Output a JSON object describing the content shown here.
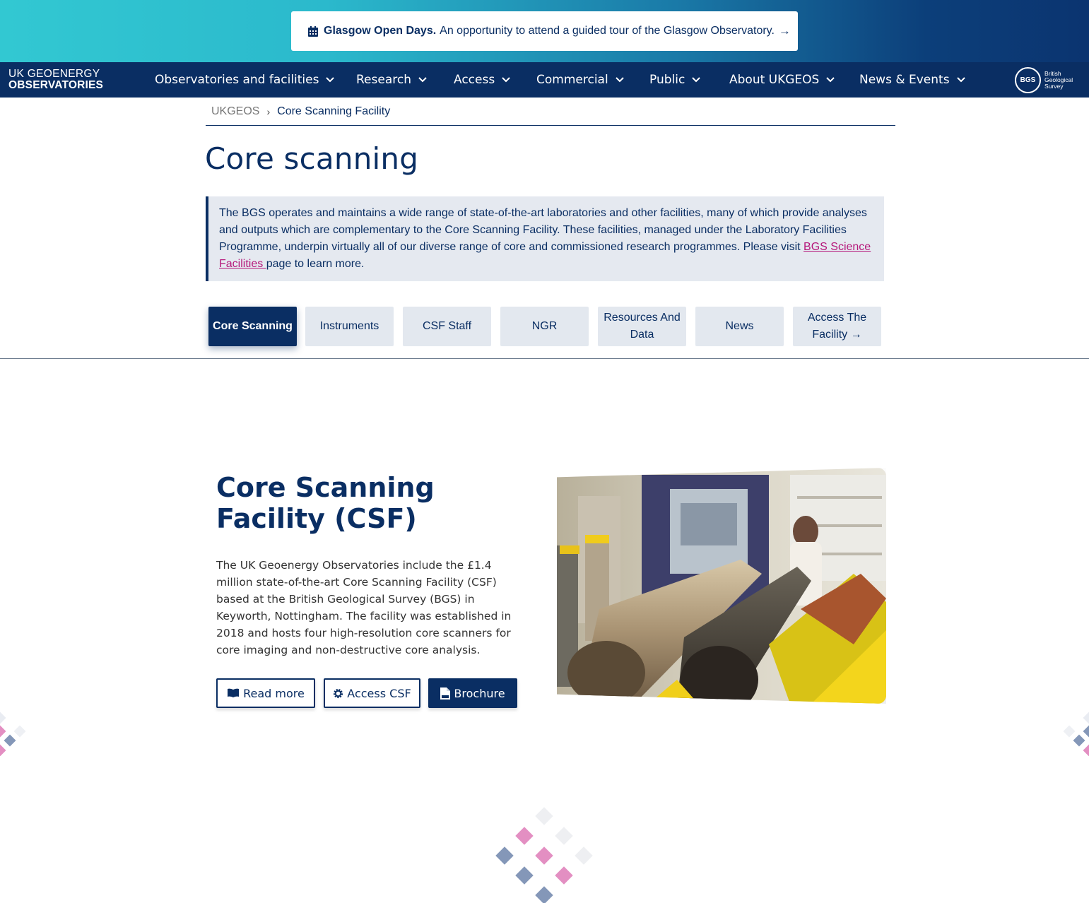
{
  "announcement": {
    "title": "Glasgow Open Days.",
    "text": "An opportunity to attend a guided tour of the Glasgow Observatory.",
    "arrow": "→"
  },
  "brand": {
    "line1": "UK GEOENERGY",
    "line2": "OBSERVATORIES"
  },
  "nav": {
    "items": [
      {
        "label": "Observatories and facilities"
      },
      {
        "label": "Research"
      },
      {
        "label": "Access"
      },
      {
        "label": "Commercial"
      },
      {
        "label": "Public"
      },
      {
        "label": "About UKGEOS"
      },
      {
        "label": "News & Events"
      }
    ],
    "partner_logo": {
      "abbr": "BGS",
      "text1": "British",
      "text2": "Geological",
      "text3": "Survey"
    }
  },
  "breadcrumb": {
    "home": "UKGEOS",
    "separator": "›",
    "current": "Core Scanning Facility"
  },
  "page_title": "Core scanning",
  "info": {
    "text": "The BGS operates and maintains a wide range of state-of-the-art laboratories and other facilities, many of which provide analyses and outputs which are complementary to the Core Scanning Facility. These facilities, managed under the Laboratory Facilities Programme, underpin virtually all of our diverse range of core and commissioned research programmes. Please visit ",
    "link": "BGS Science Facilities ",
    "suffix": "page to learn more."
  },
  "tabs": [
    {
      "label": "Core Scanning",
      "active": true
    },
    {
      "label": "Instruments"
    },
    {
      "label": "CSF Staff"
    },
    {
      "label": "NGR"
    },
    {
      "label": "Resources And Data"
    },
    {
      "label": "News"
    },
    {
      "label": "Access The Facility →"
    }
  ],
  "feature": {
    "title": "Core Scanning Facility (CSF)",
    "text": "The UK Geoenergy Observatories include the £1.4 million state-of-the-art Core Scanning Facility (CSF) based at the British Geological Survey (BGS) in Keyworth, Nottingham. The facility was established in 2018 and hosts four high-resolution core scanners for core imaging and non-destructive core analysis.",
    "buttons": [
      {
        "label": "Read more",
        "icon": "book-icon"
      },
      {
        "label": "Access CSF",
        "icon": "gear-icon"
      },
      {
        "label": "Brochure",
        "icon": "pdf-file-icon"
      }
    ]
  },
  "colors": {
    "navy": "#0a2e63",
    "pink": "#b5177a",
    "light_panel": "#e5e9f0",
    "banner_teal": "#32c8d2"
  }
}
